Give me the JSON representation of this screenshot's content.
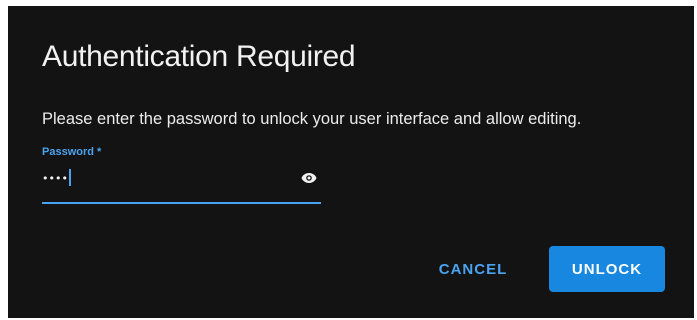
{
  "dialog": {
    "title": "Authentication Required",
    "message": "Please enter the password to unlock your user interface and allow editing."
  },
  "password_field": {
    "label": "Password *",
    "value": "••••",
    "input_type": "password",
    "toggle_icon": "eye-icon"
  },
  "actions": {
    "cancel_label": "CANCEL",
    "unlock_label": "UNLOCK"
  },
  "colors": {
    "dialog_background": "#131313",
    "accent": "#4aa3f0",
    "primary_button": "#1787e0",
    "text": "#f2f2f2"
  }
}
